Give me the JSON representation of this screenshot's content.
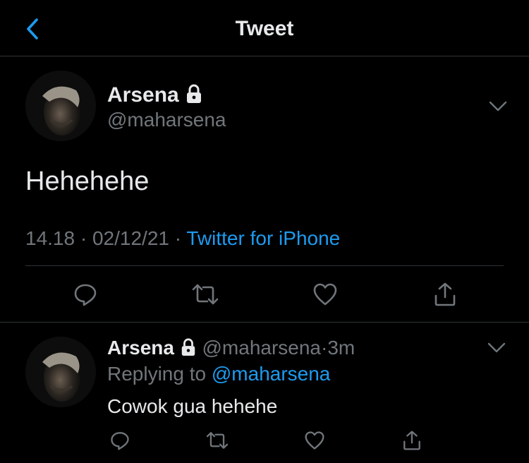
{
  "header": {
    "title": "Tweet"
  },
  "main_tweet": {
    "name": "Arsena",
    "handle": "@maharsena",
    "text": "Hehehehe",
    "time": "14.18",
    "separator": "·",
    "date": "02/12/21",
    "source": "Twitter for iPhone"
  },
  "reply": {
    "name": "Arsena",
    "handle": "@maharsena",
    "separator": "·",
    "age": "3m",
    "replying_prefix": "Replying to",
    "replying_to": "@maharsena",
    "text": "Cowok gua hehehe"
  },
  "colors": {
    "accent": "#1d9bf0",
    "text": "#e7e9ea",
    "muted": "#71767b",
    "background": "#000000"
  },
  "icons": [
    "back-icon",
    "lock-icon",
    "chevron-down-icon",
    "reply-icon",
    "retweet-icon",
    "like-icon",
    "share-icon"
  ]
}
